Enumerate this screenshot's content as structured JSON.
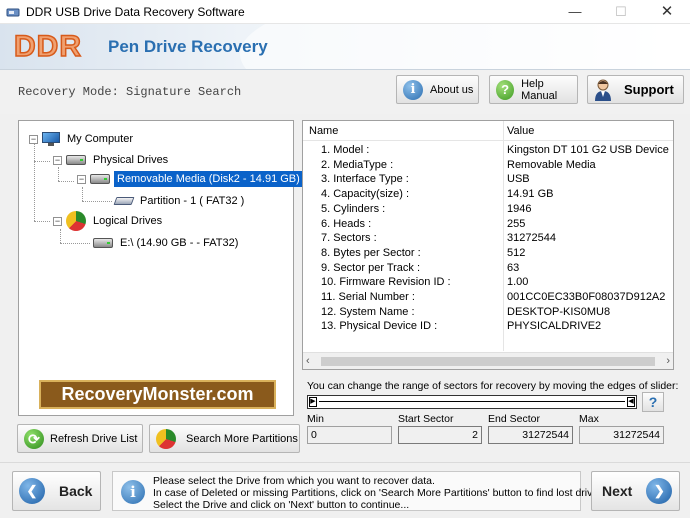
{
  "window": {
    "title": "DDR USB Drive Data Recovery Software",
    "min_glyph": "—",
    "max_glyph": "☐",
    "close_glyph": "✕"
  },
  "banner": {
    "logo": "DDR",
    "product": "Pen Drive Recovery"
  },
  "toolbar": {
    "mode_label": "Recovery Mode: Signature Search",
    "about_label": "About us",
    "help_label": "Help Manual",
    "support_label": "Support"
  },
  "tree": {
    "root": "My Computer",
    "physical": "Physical Drives",
    "removable": "Removable Media (Disk2 - 14.91 GB)",
    "partition": "Partition - 1 ( FAT32 )",
    "logical": "Logical Drives",
    "logical_drive": "E:\\ (14.90 GB -  - FAT32)",
    "selected": "Removable Media (Disk2 - 14.91 GB)"
  },
  "brand_logo": "RecoveryMonster.com",
  "left_buttons": {
    "refresh": "Refresh Drive List",
    "search": "Search More Partitions"
  },
  "info_table": {
    "headers": [
      "Name",
      "Value"
    ],
    "rows": [
      {
        "name": "1. Model :",
        "value": "Kingston DT 101 G2 USB Device"
      },
      {
        "name": "2. MediaType :",
        "value": "Removable Media"
      },
      {
        "name": "3. Interface Type :",
        "value": "USB"
      },
      {
        "name": "4. Capacity(size) :",
        "value": "14.91 GB"
      },
      {
        "name": "5. Cylinders :",
        "value": "1946"
      },
      {
        "name": "6. Heads :",
        "value": "255"
      },
      {
        "name": "7. Sectors :",
        "value": "31272544"
      },
      {
        "name": "8. Bytes per Sector :",
        "value": "512"
      },
      {
        "name": "9. Sector per Track :",
        "value": "63"
      },
      {
        "name": "10. Firmware Revision ID :",
        "value": "1.00"
      },
      {
        "name": "11. Serial Number :",
        "value": "001CC0EC33B0F08037D912A2"
      },
      {
        "name": "12. System Name :",
        "value": "DESKTOP-KIS0MU8"
      },
      {
        "name": "13. Physical Device ID :",
        "value": "PHYSICALDRIVE2"
      }
    ]
  },
  "range": {
    "hint": "You can change the range of sectors for recovery by moving the edges of slider:",
    "help_glyph": "?",
    "min_label": "Min",
    "min_value": "0",
    "start_label": "Start Sector",
    "start_value": "2",
    "end_label": "End Sector",
    "end_value": "31272544",
    "max_label": "Max",
    "max_value": "31272544"
  },
  "bottom": {
    "back_label": "Back",
    "next_label": "Next",
    "message_lines": [
      "Please select the Drive from which you want to recover data.",
      "In case of Deleted or missing Partitions, click on 'Search More Partitions' button to find lost drives.",
      "Select the Drive and click on 'Next' button to continue..."
    ]
  }
}
